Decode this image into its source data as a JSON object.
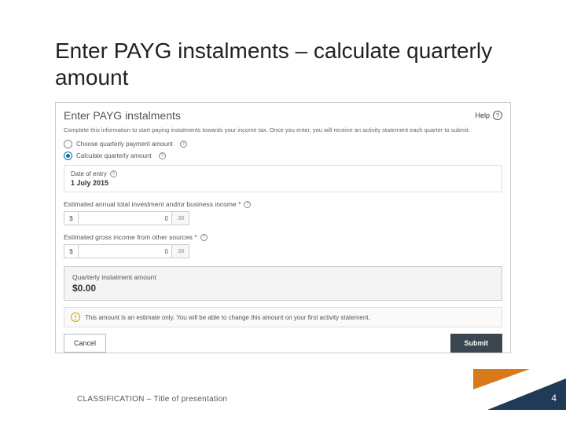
{
  "slide": {
    "title": "Enter PAYG instalments – calculate quarterly amount",
    "footer": "CLASSIFICATION – Title of presentation",
    "page_number": "4"
  },
  "panel": {
    "title": "Enter PAYG instalments",
    "help_label": "Help",
    "intro": "Complete this information to start paying instalments towards your income tax. Once you enter, you will receive an activity statement each quarter to submit.",
    "option_choose": "Choose quarterly payment amount",
    "option_calculate": "Calculate quarterly amount",
    "date_label": "Date of entry",
    "date_value": "1 July 2015",
    "income_label": "Estimated annual total investment and/or business income *",
    "other_income_label": "Estimated gross income from other sources *",
    "currency_symbol": "$",
    "amount_value": "0",
    "cents": ".00",
    "result_label": "Quarterly instalment amount",
    "result_value": "$0.00",
    "note": "This amount is an estimate only. You will be able to change this amount on your first activity statement.",
    "cancel": "Cancel",
    "submit": "Submit"
  }
}
